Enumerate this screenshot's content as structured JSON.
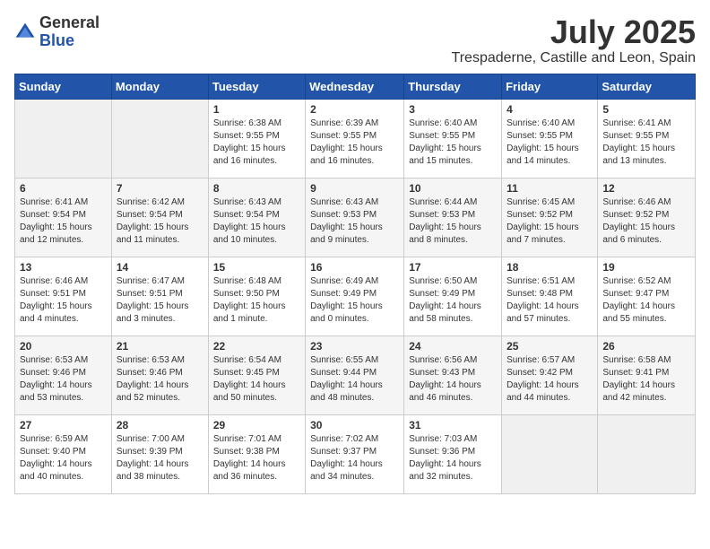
{
  "header": {
    "logo_general": "General",
    "logo_blue": "Blue",
    "month": "July 2025",
    "location": "Trespaderne, Castille and Leon, Spain"
  },
  "weekdays": [
    "Sunday",
    "Monday",
    "Tuesday",
    "Wednesday",
    "Thursday",
    "Friday",
    "Saturday"
  ],
  "weeks": [
    [
      {
        "day": "",
        "info": ""
      },
      {
        "day": "",
        "info": ""
      },
      {
        "day": "1",
        "info": "Sunrise: 6:38 AM\nSunset: 9:55 PM\nDaylight: 15 hours\nand 16 minutes."
      },
      {
        "day": "2",
        "info": "Sunrise: 6:39 AM\nSunset: 9:55 PM\nDaylight: 15 hours\nand 16 minutes."
      },
      {
        "day": "3",
        "info": "Sunrise: 6:40 AM\nSunset: 9:55 PM\nDaylight: 15 hours\nand 15 minutes."
      },
      {
        "day": "4",
        "info": "Sunrise: 6:40 AM\nSunset: 9:55 PM\nDaylight: 15 hours\nand 14 minutes."
      },
      {
        "day": "5",
        "info": "Sunrise: 6:41 AM\nSunset: 9:55 PM\nDaylight: 15 hours\nand 13 minutes."
      }
    ],
    [
      {
        "day": "6",
        "info": "Sunrise: 6:41 AM\nSunset: 9:54 PM\nDaylight: 15 hours\nand 12 minutes."
      },
      {
        "day": "7",
        "info": "Sunrise: 6:42 AM\nSunset: 9:54 PM\nDaylight: 15 hours\nand 11 minutes."
      },
      {
        "day": "8",
        "info": "Sunrise: 6:43 AM\nSunset: 9:54 PM\nDaylight: 15 hours\nand 10 minutes."
      },
      {
        "day": "9",
        "info": "Sunrise: 6:43 AM\nSunset: 9:53 PM\nDaylight: 15 hours\nand 9 minutes."
      },
      {
        "day": "10",
        "info": "Sunrise: 6:44 AM\nSunset: 9:53 PM\nDaylight: 15 hours\nand 8 minutes."
      },
      {
        "day": "11",
        "info": "Sunrise: 6:45 AM\nSunset: 9:52 PM\nDaylight: 15 hours\nand 7 minutes."
      },
      {
        "day": "12",
        "info": "Sunrise: 6:46 AM\nSunset: 9:52 PM\nDaylight: 15 hours\nand 6 minutes."
      }
    ],
    [
      {
        "day": "13",
        "info": "Sunrise: 6:46 AM\nSunset: 9:51 PM\nDaylight: 15 hours\nand 4 minutes."
      },
      {
        "day": "14",
        "info": "Sunrise: 6:47 AM\nSunset: 9:51 PM\nDaylight: 15 hours\nand 3 minutes."
      },
      {
        "day": "15",
        "info": "Sunrise: 6:48 AM\nSunset: 9:50 PM\nDaylight: 15 hours\nand 1 minute."
      },
      {
        "day": "16",
        "info": "Sunrise: 6:49 AM\nSunset: 9:49 PM\nDaylight: 15 hours\nand 0 minutes."
      },
      {
        "day": "17",
        "info": "Sunrise: 6:50 AM\nSunset: 9:49 PM\nDaylight: 14 hours\nand 58 minutes."
      },
      {
        "day": "18",
        "info": "Sunrise: 6:51 AM\nSunset: 9:48 PM\nDaylight: 14 hours\nand 57 minutes."
      },
      {
        "day": "19",
        "info": "Sunrise: 6:52 AM\nSunset: 9:47 PM\nDaylight: 14 hours\nand 55 minutes."
      }
    ],
    [
      {
        "day": "20",
        "info": "Sunrise: 6:53 AM\nSunset: 9:46 PM\nDaylight: 14 hours\nand 53 minutes."
      },
      {
        "day": "21",
        "info": "Sunrise: 6:53 AM\nSunset: 9:46 PM\nDaylight: 14 hours\nand 52 minutes."
      },
      {
        "day": "22",
        "info": "Sunrise: 6:54 AM\nSunset: 9:45 PM\nDaylight: 14 hours\nand 50 minutes."
      },
      {
        "day": "23",
        "info": "Sunrise: 6:55 AM\nSunset: 9:44 PM\nDaylight: 14 hours\nand 48 minutes."
      },
      {
        "day": "24",
        "info": "Sunrise: 6:56 AM\nSunset: 9:43 PM\nDaylight: 14 hours\nand 46 minutes."
      },
      {
        "day": "25",
        "info": "Sunrise: 6:57 AM\nSunset: 9:42 PM\nDaylight: 14 hours\nand 44 minutes."
      },
      {
        "day": "26",
        "info": "Sunrise: 6:58 AM\nSunset: 9:41 PM\nDaylight: 14 hours\nand 42 minutes."
      }
    ],
    [
      {
        "day": "27",
        "info": "Sunrise: 6:59 AM\nSunset: 9:40 PM\nDaylight: 14 hours\nand 40 minutes."
      },
      {
        "day": "28",
        "info": "Sunrise: 7:00 AM\nSunset: 9:39 PM\nDaylight: 14 hours\nand 38 minutes."
      },
      {
        "day": "29",
        "info": "Sunrise: 7:01 AM\nSunset: 9:38 PM\nDaylight: 14 hours\nand 36 minutes."
      },
      {
        "day": "30",
        "info": "Sunrise: 7:02 AM\nSunset: 9:37 PM\nDaylight: 14 hours\nand 34 minutes."
      },
      {
        "day": "31",
        "info": "Sunrise: 7:03 AM\nSunset: 9:36 PM\nDaylight: 14 hours\nand 32 minutes."
      },
      {
        "day": "",
        "info": ""
      },
      {
        "day": "",
        "info": ""
      }
    ]
  ]
}
